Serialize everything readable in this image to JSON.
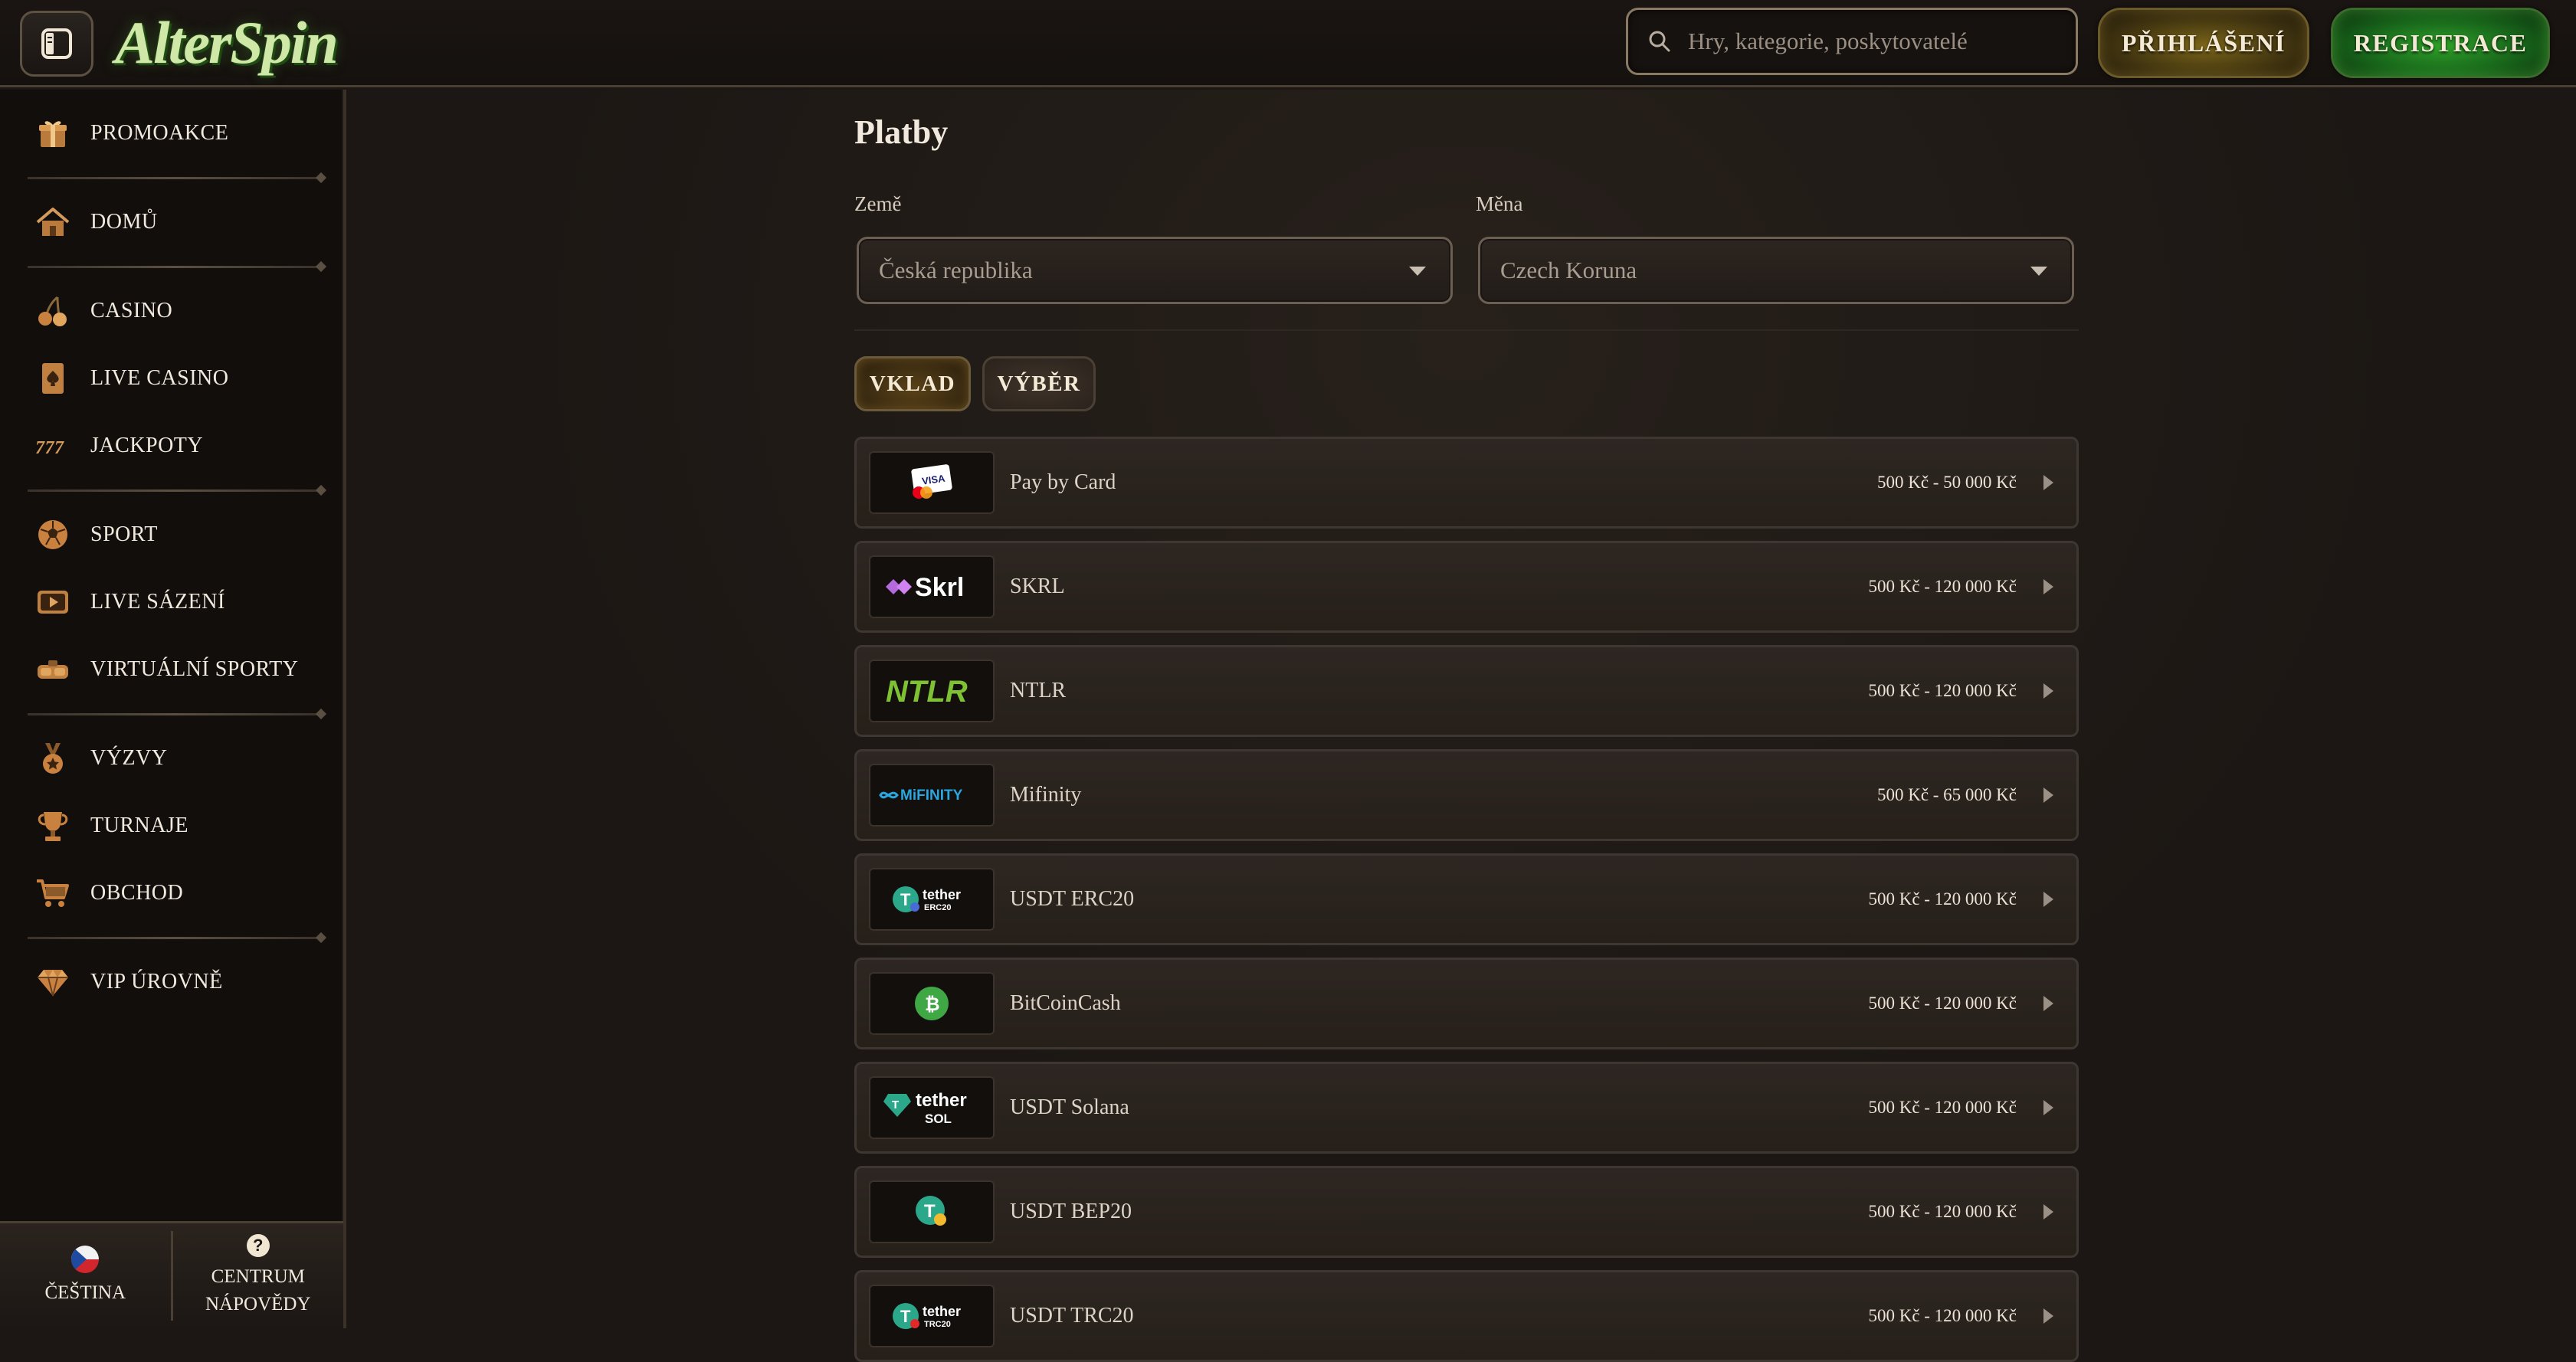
{
  "header": {
    "logo_text": "AlterSpin",
    "search_placeholder": "Hry, kategorie, poskytovatelé",
    "login_label": "PŘIHLÁŠENÍ",
    "register_label": "REGISTRACE"
  },
  "sidebar": {
    "items": [
      {
        "label": "PROMOAKCE",
        "icon": "gift-icon"
      },
      {
        "label": "DOMŮ",
        "icon": "home-icon"
      },
      {
        "label": "CASINO",
        "icon": "cherries-icon"
      },
      {
        "label": "LIVE CASINO",
        "icon": "card-spade-icon"
      },
      {
        "label": "JACKPOTY",
        "icon": "triple-seven-icon"
      },
      {
        "label": "SPORT",
        "icon": "football-icon"
      },
      {
        "label": "LIVE SÁZENÍ",
        "icon": "play-screen-icon"
      },
      {
        "label": "VIRTUÁLNÍ SPORTY",
        "icon": "vr-headset-icon"
      },
      {
        "label": "VÝZVY",
        "icon": "medal-icon"
      },
      {
        "label": "TURNAJE",
        "icon": "trophy-icon"
      },
      {
        "label": "OBCHOD",
        "icon": "cart-icon"
      },
      {
        "label": "VIP ÚROVNĚ",
        "icon": "diamond-icon"
      }
    ],
    "footer": {
      "language_label": "ČEŠTINA",
      "help_line1": "CENTRUM",
      "help_line2": "NÁPOVĚDY",
      "help_glyph": "?"
    }
  },
  "main": {
    "title": "Platby",
    "country_label": "Země",
    "country_value": "Česká republika",
    "currency_label": "Měna",
    "currency_value": "Czech Koruna",
    "tabs": [
      {
        "label": "VKLAD",
        "active": true
      },
      {
        "label": "VÝBĚR",
        "active": false
      }
    ],
    "payments": [
      {
        "name": "Pay by Card",
        "range": "500 Kč - 50 000 Kč",
        "logo_text": "VISA"
      },
      {
        "name": "SKRL",
        "range": "500 Kč - 120 000 Kč",
        "logo_text": "Skrl"
      },
      {
        "name": "NTLR",
        "range": "500 Kč - 120 000 Kč",
        "logo_text": "NTLR"
      },
      {
        "name": "Mifinity",
        "range": "500 Kč - 65 000 Kč",
        "logo_text": "MiFINITY"
      },
      {
        "name": "USDT ERC20",
        "range": "500 Kč - 120 000 Kč",
        "logo_text": "tether",
        "logo_sub": "ERC20"
      },
      {
        "name": "BitCoinCash",
        "range": "500 Kč - 120 000 Kč",
        "logo_text": "₿"
      },
      {
        "name": "USDT Solana",
        "range": "500 Kč - 120 000 Kč",
        "logo_text": "tether",
        "logo_sub": "SOL"
      },
      {
        "name": "USDT BEP20",
        "range": "500 Kč - 120 000 Kč",
        "logo_text": "T"
      },
      {
        "name": "USDT TRC20",
        "range": "500 Kč - 120 000 Kč",
        "logo_text": "tether",
        "logo_sub": "TRC20"
      }
    ]
  }
}
